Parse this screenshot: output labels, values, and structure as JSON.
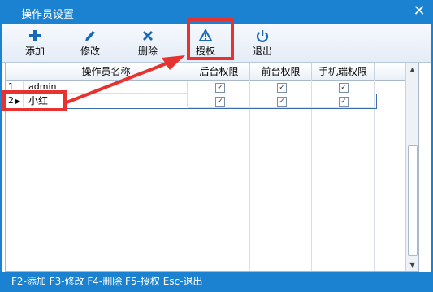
{
  "window": {
    "title": "操作员设置",
    "close_symbol": "✕"
  },
  "toolbar": {
    "add_label": "添加",
    "edit_label": "修改",
    "delete_label": "删除",
    "authorize_label": "授权",
    "exit_label": "退出"
  },
  "table": {
    "columns": [
      "操作员名称",
      "后台权限",
      "前台权限",
      "手机端权限"
    ],
    "rows": [
      {
        "num": "1",
        "name": "admin",
        "backend": true,
        "frontend": true,
        "mobile": true,
        "current": false
      },
      {
        "num": "2",
        "name": "小红",
        "backend": true,
        "frontend": true,
        "mobile": true,
        "current": true
      }
    ]
  },
  "status": {
    "text": "F2-添加 F3-修改 F4-删除 F5-授权 Esc-退出"
  },
  "colors": {
    "titlebar": "#1b82d1",
    "accent": "#1b82d1",
    "highlight": "#e8322f"
  },
  "icons": [
    "plus-icon",
    "pencil-icon",
    "x-icon",
    "warning-icon",
    "power-icon",
    "check-icon",
    "row-pointer-icon"
  ]
}
